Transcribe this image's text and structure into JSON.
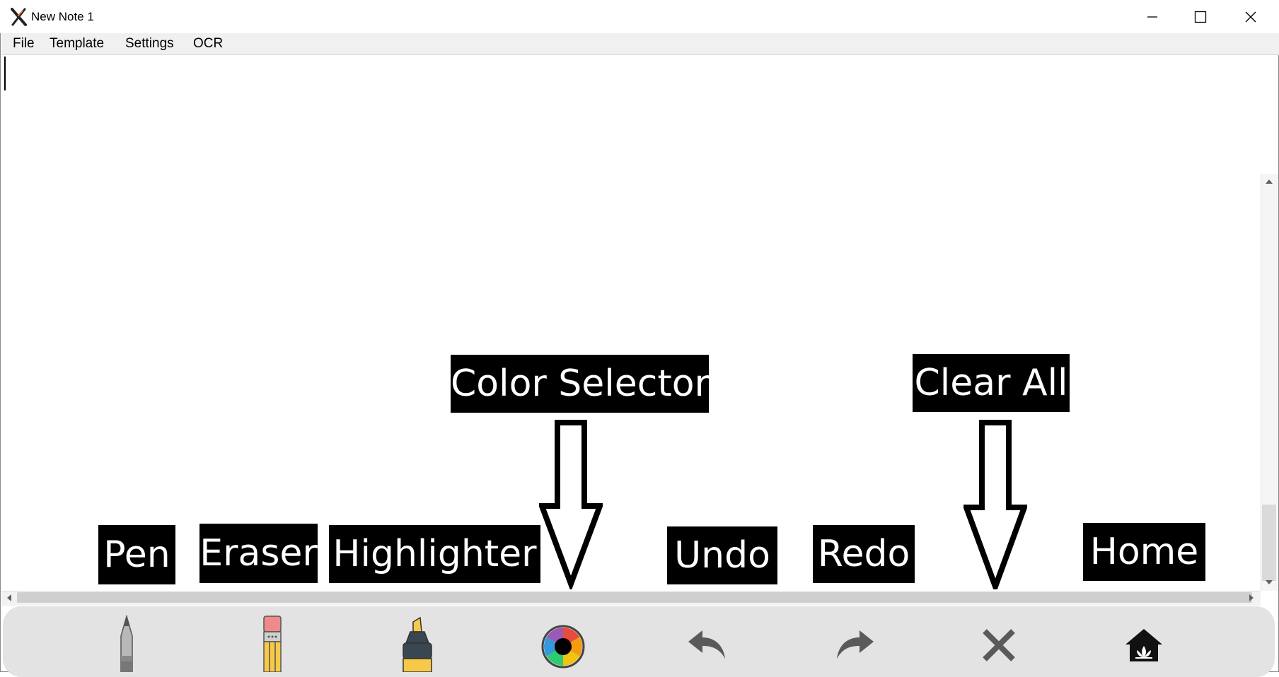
{
  "window": {
    "title": "New Note 1",
    "app_icon": "x-app-icon",
    "controls": [
      "minimize-icon",
      "maximize-icon",
      "close-icon"
    ]
  },
  "menu": {
    "items": [
      {
        "label": "File"
      },
      {
        "label": "Template"
      },
      {
        "label": "Settings"
      },
      {
        "label": "OCR"
      }
    ]
  },
  "toolbar": {
    "tools": [
      {
        "name": "pen",
        "icon": "pen-icon"
      },
      {
        "name": "eraser",
        "icon": "pencil-eraser-icon"
      },
      {
        "name": "highlighter",
        "icon": "highlighter-icon"
      },
      {
        "name": "color-selector",
        "icon": "color-wheel-icon"
      },
      {
        "name": "undo",
        "icon": "undo-arrow-icon"
      },
      {
        "name": "redo",
        "icon": "redo-arrow-icon"
      },
      {
        "name": "clear-all",
        "icon": "x-clear-icon"
      },
      {
        "name": "home",
        "icon": "home-lotus-icon"
      }
    ]
  },
  "annotations": {
    "pen": "Pen",
    "eraser": "Eraser",
    "highlighter": "Highlighter",
    "color_selector": "Color Selector",
    "undo": "Undo",
    "redo": "Redo",
    "clear_all": "Clear All",
    "home": "Home"
  },
  "colors": {
    "toolbar_bg": "#e3e3e3",
    "label_bg": "#000000",
    "label_text": "#ffffff",
    "icon_gray": "#5a5a5a",
    "highlighter_yellow": "#f7c948",
    "pencil_yellow": "#f7c948",
    "eraser_pink": "#f08a8a"
  }
}
